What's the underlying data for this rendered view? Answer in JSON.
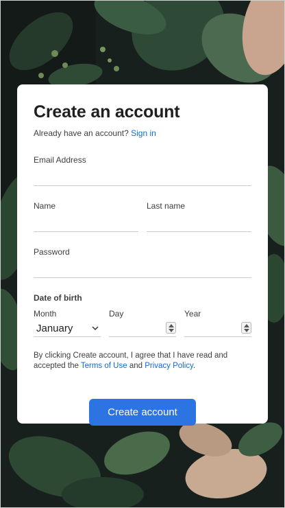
{
  "form": {
    "title": "Create an account",
    "signin_prompt": "Already have an account?",
    "signin_link": "Sign in",
    "email_label": "Email Address",
    "first_name_label": "Name",
    "last_name_label": "Last name",
    "password_label": "Password",
    "dob_title": "Date of birth",
    "month_label": "Month",
    "month_value": "January",
    "day_label": "Day",
    "year_label": "Year",
    "terms_prefix": "By clicking Create account, I agree that I have read and accepted the",
    "terms_link": "Terms of Use",
    "terms_and": "and",
    "privacy_link": "Privacy Policy",
    "terms_suffix": ".",
    "submit_label": "Create account"
  },
  "colors": {
    "accent": "#2b74e2",
    "link": "#0e6ad6"
  },
  "icons": {
    "month_dropdown": "chevron-down-icon",
    "number_stepper": "stepper-arrows-icon"
  }
}
